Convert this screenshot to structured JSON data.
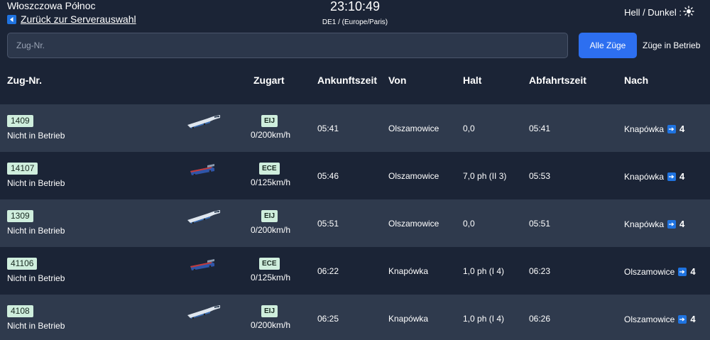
{
  "header": {
    "station": "Włoszczowa Północ",
    "back_label": "Zurück zur Serverauswahl",
    "clock": "23:10:49",
    "timezone": "DE1 / (Europe/Paris)",
    "theme_label": "Hell / Dunkel :"
  },
  "search": {
    "placeholder": "Zug-Nr.",
    "value": "",
    "all_trains_label": "Alle Züge",
    "active_trains_label": "Züge in Betrieb"
  },
  "columns": {
    "number": "Zug-Nr.",
    "type": "Zugart",
    "arrival": "Ankunftszeit",
    "from": "Von",
    "halt": "Halt",
    "departure": "Abfahrtszeit",
    "to": "Nach"
  },
  "trains": [
    {
      "number": "1409",
      "status": "Nicht in Betrieb",
      "type": "EIJ",
      "speed": "0/200km/h",
      "arrival": "05:41",
      "from": "Olszamowice",
      "halt": "0,0",
      "departure": "05:41",
      "to": "Knapówka",
      "platform": "4",
      "icon": "high-speed-train-icon"
    },
    {
      "number": "14107",
      "status": "Nicht in Betrieb",
      "type": "ECE",
      "speed": "0/125km/h",
      "arrival": "05:46",
      "from": "Olszamowice",
      "halt": "7,0 ph (II 3)",
      "departure": "05:53",
      "to": "Knapówka",
      "platform": "4",
      "icon": "locomotive-icon"
    },
    {
      "number": "1309",
      "status": "Nicht in Betrieb",
      "type": "EIJ",
      "speed": "0/200km/h",
      "arrival": "05:51",
      "from": "Olszamowice",
      "halt": "0,0",
      "departure": "05:51",
      "to": "Knapówka",
      "platform": "4",
      "icon": "high-speed-train-icon"
    },
    {
      "number": "41106",
      "status": "Nicht in Betrieb",
      "type": "ECE",
      "speed": "0/125km/h",
      "arrival": "06:22",
      "from": "Knapówka",
      "halt": "1,0 ph (I 4)",
      "departure": "06:23",
      "to": "Olszamowice",
      "platform": "4",
      "icon": "locomotive-icon"
    },
    {
      "number": "4108",
      "status": "Nicht in Betrieb",
      "type": "EIJ",
      "speed": "0/200km/h",
      "arrival": "06:25",
      "from": "Knapówka",
      "halt": "1,0 ph (I 4)",
      "departure": "06:26",
      "to": "Olszamowice",
      "platform": "4",
      "icon": "high-speed-train-icon"
    }
  ],
  "colors": {
    "background": "#1b2436",
    "row_alt": "#2f3a4d",
    "accent": "#2d6ff0",
    "badge": "#cfeedd"
  }
}
